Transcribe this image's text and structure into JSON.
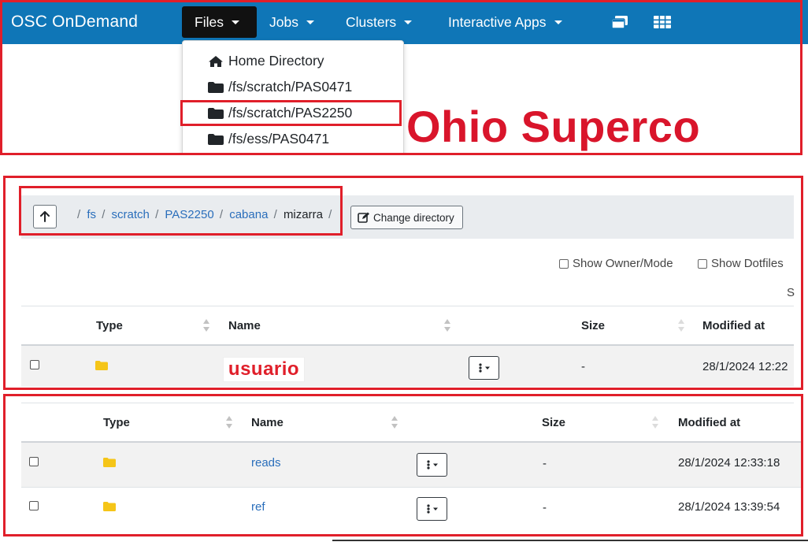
{
  "navbar": {
    "brand": "OSC OnDemand",
    "menus": [
      "Files",
      "Jobs",
      "Clusters",
      "Interactive Apps"
    ],
    "icons": [
      "windows-icon",
      "apps-grid-icon"
    ],
    "color": "#0f76b7"
  },
  "files_dropdown": {
    "items": [
      "Home Directory",
      "/fs/scratch/PAS0471",
      "/fs/scratch/PAS2250",
      "/fs/ess/PAS0471"
    ],
    "highlighted_index": 2
  },
  "banner_text": "Ohio Superco",
  "path": {
    "segments": [
      "fs",
      "scratch",
      "PAS2250",
      "cabana"
    ],
    "current": "mizarra",
    "root_sep": "/",
    "change_directory_label": "Change directory"
  },
  "options": {
    "show_owner_mode": "Show Owner/Mode",
    "show_dotfiles": "Show Dotfiles",
    "truncated_label": "S"
  },
  "table1": {
    "headers": [
      "Type",
      "Name",
      "Size",
      "Modified at"
    ],
    "rows": [
      {
        "name": "usuario",
        "size": "-",
        "modified": "28/1/2024 12:22"
      }
    ]
  },
  "table2": {
    "headers": [
      "Type",
      "Name",
      "Size",
      "Modified at"
    ],
    "rows": [
      {
        "name": "reads",
        "size": "-",
        "modified": "28/1/2024 12:33:18"
      },
      {
        "name": "ref",
        "size": "-",
        "modified": "28/1/2024 13:39:54"
      }
    ]
  },
  "colors": {
    "highlight": "#e01f2a",
    "link": "#2a6ebb",
    "folder": "#f5c518"
  }
}
